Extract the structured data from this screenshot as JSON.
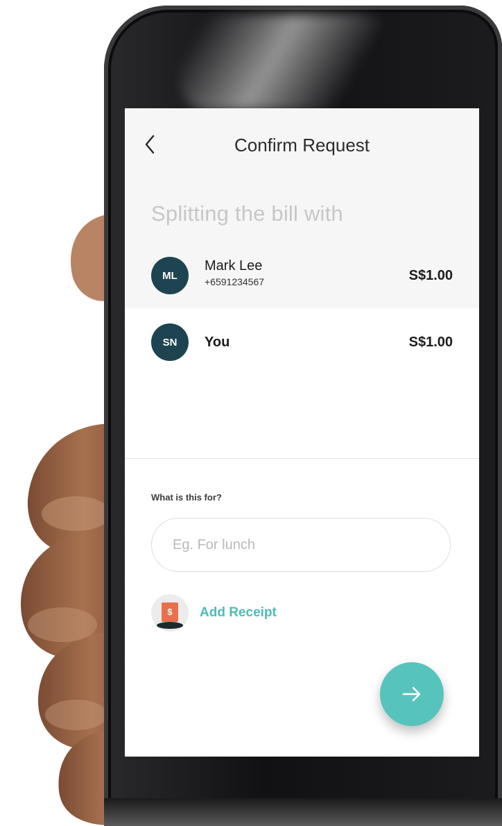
{
  "header": {
    "title": "Confirm Request",
    "back_icon": "chevron-left-icon"
  },
  "split": {
    "heading": "Splitting the bill with",
    "people": [
      {
        "initials": "ML",
        "name": "Mark Lee",
        "phone": "+6591234567",
        "amount": "S$1.00"
      },
      {
        "initials": "SN",
        "name": "You",
        "amount": "S$1.00"
      }
    ]
  },
  "purpose": {
    "label": "What is this for?",
    "placeholder": "Eg. For lunch",
    "value": ""
  },
  "receipt": {
    "label": "Add Receipt",
    "icon": "receipt-icon",
    "icon_symbol": "$"
  },
  "next_button": {
    "icon": "arrow-right-icon"
  },
  "colors": {
    "avatar": "#1d4450",
    "accent": "#57c3bd",
    "link": "#4dbdb6",
    "receipt": "#e8704a"
  }
}
